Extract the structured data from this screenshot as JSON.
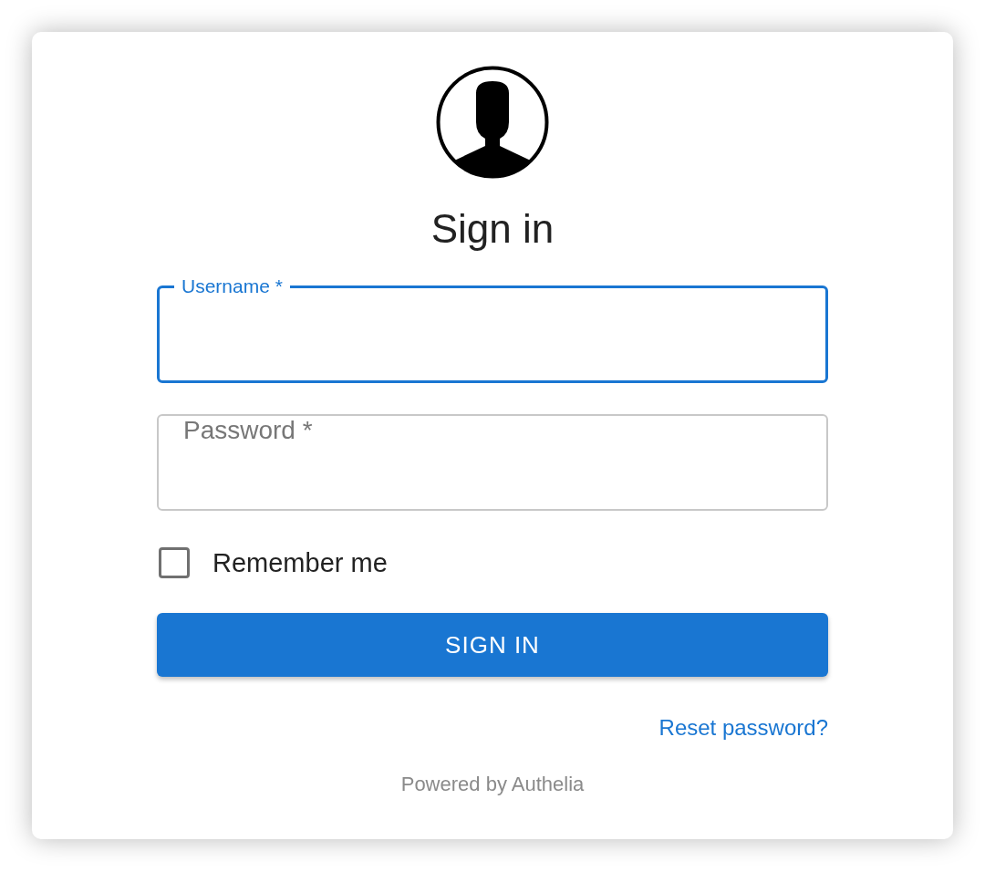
{
  "title": "Sign in",
  "fields": [
    {
      "label": "Username *",
      "focused": true
    },
    {
      "placeholder": "Password *",
      "focused": false
    }
  ],
  "remember": {
    "label": "Remember me",
    "checked": false
  },
  "submit": "SIGN IN",
  "reset_link": "Reset password?",
  "footer": "Powered by Authelia"
}
